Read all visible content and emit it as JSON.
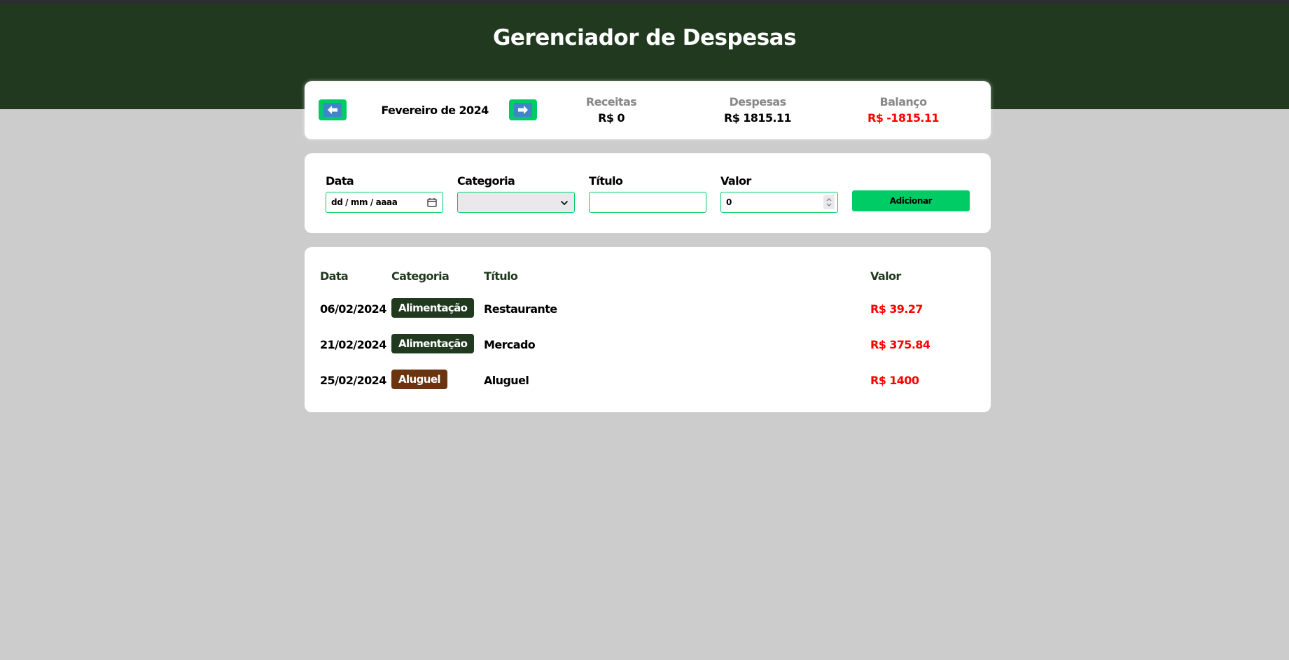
{
  "app": {
    "title": "Gerenciador de Despesas"
  },
  "colors": {
    "header_bg": "#213a1f",
    "accent": "#00cc66",
    "nav_arrow_bg": "#3f86c8",
    "negative": "#ff0000",
    "category_alimentacao": "#213a1f",
    "category_aluguel": "#6b3410"
  },
  "info": {
    "prev_icon": "arrow-left-icon",
    "next_icon": "arrow-right-icon",
    "month": "Fevereiro de 2024",
    "receitas_label": "Receitas",
    "receitas_value": "R$ 0",
    "despesas_label": "Despesas",
    "despesas_value": "R$ 1815.11",
    "balanco_label": "Balanço",
    "balanco_value": "R$ -1815.11"
  },
  "form": {
    "data_label": "Data",
    "data_placeholder": "dd / mm / aaaa",
    "categoria_label": "Categoria",
    "categoria_value": "",
    "titulo_label": "Título",
    "titulo_value": "",
    "valor_label": "Valor",
    "valor_value": "0",
    "add_label": "Adicionar"
  },
  "table": {
    "headers": {
      "data": "Data",
      "categoria": "Categoria",
      "titulo": "Título",
      "valor": "Valor"
    },
    "rows": [
      {
        "data": "06/02/2024",
        "categoria": "Alimentação",
        "titulo": "Restaurante",
        "valor": "R$ 39.27"
      },
      {
        "data": "21/02/2024",
        "categoria": "Alimentação",
        "titulo": "Mercado",
        "valor": "R$ 375.84"
      },
      {
        "data": "25/02/2024",
        "categoria": "Aluguel",
        "titulo": "Aluguel",
        "valor": "R$ 1400"
      }
    ]
  }
}
